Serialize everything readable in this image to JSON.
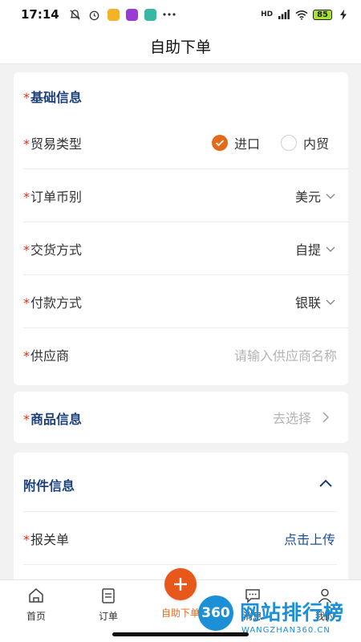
{
  "status_bar": {
    "time": "17:14",
    "network": "HD",
    "battery": "85"
  },
  "nav": {
    "title": "自助下单"
  },
  "required_mark": "*",
  "basic_info": {
    "title": "基础信息",
    "trade_type": {
      "label": "贸易类型",
      "options": [
        "进口",
        "内贸"
      ],
      "selected": "进口"
    },
    "currency": {
      "label": "订单币别",
      "value": "美元"
    },
    "delivery": {
      "label": "交货方式",
      "value": "自提"
    },
    "payment": {
      "label": "付款方式",
      "value": "银联"
    },
    "supplier": {
      "label": "供应商",
      "placeholder": "请输入供应商名称"
    }
  },
  "goods_info": {
    "title": "商品信息",
    "action": "去选择"
  },
  "attachment_info": {
    "title": "附件信息",
    "customs": {
      "label": "报关单",
      "action": "点击上传"
    }
  },
  "tabs": [
    {
      "label": "首页",
      "icon": "home-icon"
    },
    {
      "label": "订单",
      "icon": "order-icon"
    },
    {
      "label": "自助下单",
      "icon": "plus-icon"
    },
    {
      "label": "消息",
      "icon": "message-icon"
    },
    {
      "label": "我的",
      "icon": "user-icon"
    }
  ],
  "watermark": {
    "badge": "360",
    "text": "网站排行榜",
    "sub": "WANGZHAN360.CN"
  },
  "colors": {
    "accent": "#e46a1a",
    "title_blue": "#1b3f7a",
    "link_blue": "#1b4f9a",
    "required": "#d9301d"
  }
}
